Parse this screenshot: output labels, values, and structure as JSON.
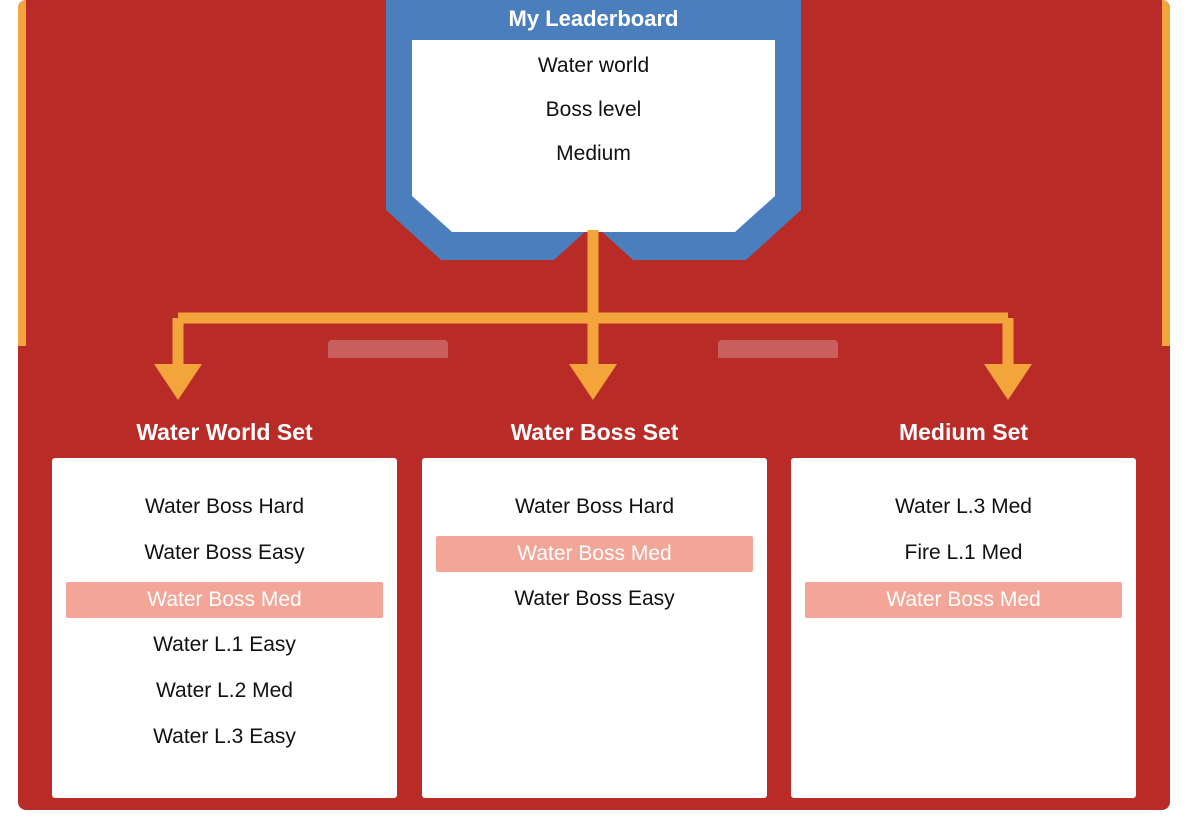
{
  "colors": {
    "panel": "#b82b27",
    "badge_blue": "#4a7ebd",
    "arrow_orange": "#f3a43a",
    "highlight": "#f3a697"
  },
  "leaderboard": {
    "title": "My Leaderboard",
    "attributes": [
      "Water world",
      "Boss level",
      "Medium"
    ]
  },
  "sets": [
    {
      "title": "Water World Set",
      "items": [
        {
          "label": "Water Boss Hard",
          "highlight": false
        },
        {
          "label": "Water Boss Easy",
          "highlight": false
        },
        {
          "label": "Water Boss Med",
          "highlight": true
        },
        {
          "label": "Water L.1 Easy",
          "highlight": false
        },
        {
          "label": "Water L.2 Med",
          "highlight": false
        },
        {
          "label": "Water L.3 Easy",
          "highlight": false
        }
      ]
    },
    {
      "title": "Water Boss Set",
      "items": [
        {
          "label": "Water Boss Hard",
          "highlight": false
        },
        {
          "label": "Water Boss Med",
          "highlight": true
        },
        {
          "label": "Water Boss Easy",
          "highlight": false
        }
      ]
    },
    {
      "title": "Medium Set",
      "items": [
        {
          "label": "Water L.3 Med",
          "highlight": false
        },
        {
          "label": "Fire L.1 Med",
          "highlight": false
        },
        {
          "label": "Water Boss Med",
          "highlight": true
        }
      ]
    }
  ]
}
